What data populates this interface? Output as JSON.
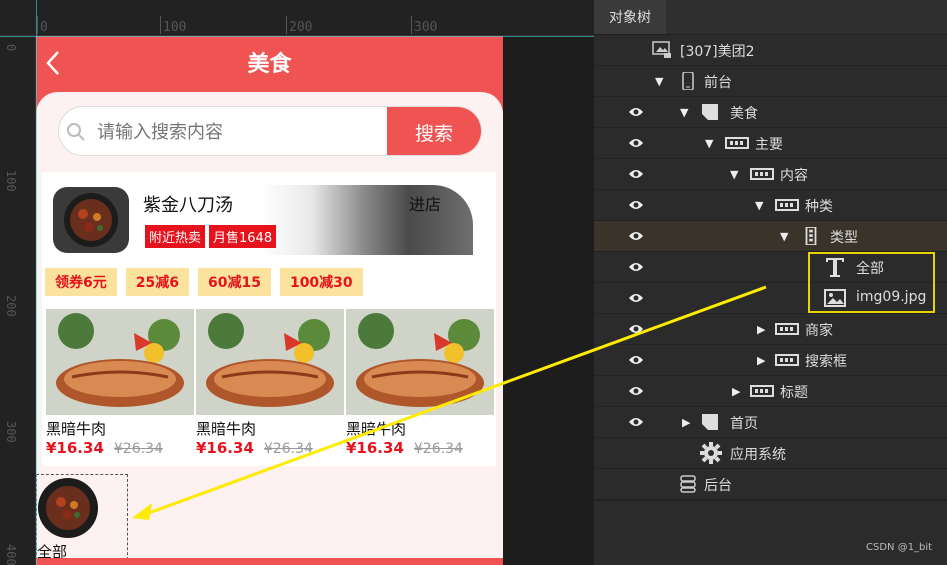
{
  "ruler": {
    "h_ticks": [
      "0",
      "100",
      "200",
      "300"
    ],
    "v_ticks": [
      "0",
      "100",
      "200",
      "300",
      "400"
    ]
  },
  "phone": {
    "title": "美食",
    "back_icon": "chevron-left-icon",
    "search": {
      "placeholder": "请输入搜索内容",
      "button": "搜索"
    },
    "store": {
      "name": "紫金八刀汤",
      "enter": "进店",
      "tags": [
        "附近热卖",
        "月售1648"
      ]
    },
    "coupons": [
      "领券6元",
      "25减6",
      "60减15",
      "100减30"
    ],
    "products": [
      {
        "name": "黑暗牛肉",
        "price": "¥16.34",
        "old_price": "¥26.34"
      },
      {
        "name": "黑暗牛肉",
        "price": "¥16.34",
        "old_price": "¥26.34"
      },
      {
        "name": "黑暗牛肉",
        "price": "¥16.34",
        "old_price": "¥26.34"
      }
    ],
    "type_item": {
      "label": "全部"
    }
  },
  "panel": {
    "tab": "对象树",
    "tree": [
      {
        "label": "[307]美团2",
        "icon": "project-icon",
        "eye": false,
        "arrow": ""
      },
      {
        "label": "前台",
        "icon": "phone-icon",
        "eye": false,
        "arrow": "▼"
      },
      {
        "label": "美食",
        "icon": "page-icon",
        "eye": true,
        "arrow": "▼"
      },
      {
        "label": "主要",
        "icon": "panel-icon",
        "eye": true,
        "arrow": "▼"
      },
      {
        "label": "内容",
        "icon": "panel-icon",
        "eye": true,
        "arrow": "▼"
      },
      {
        "label": "种类",
        "icon": "panel-icon",
        "eye": true,
        "arrow": "▼"
      },
      {
        "label": "类型",
        "icon": "vertical-panel-icon",
        "eye": true,
        "arrow": "▼"
      },
      {
        "label": "全部",
        "icon": "text-icon",
        "eye": true,
        "arrow": ""
      },
      {
        "label": "img09.jpg",
        "icon": "image-icon",
        "eye": true,
        "arrow": ""
      },
      {
        "label": "商家",
        "icon": "panel-icon",
        "eye": true,
        "arrow": "▶"
      },
      {
        "label": "搜索框",
        "icon": "panel-icon",
        "eye": true,
        "arrow": "▶"
      },
      {
        "label": "标题",
        "icon": "panel-icon",
        "eye": true,
        "arrow": "▶"
      },
      {
        "label": "首页",
        "icon": "page-icon",
        "eye": true,
        "arrow": "▶"
      },
      {
        "label": "应用系统",
        "icon": "gear-icon",
        "eye": false,
        "arrow": ""
      },
      {
        "label": "后台",
        "icon": "backend-icon",
        "eye": false,
        "arrow": ""
      }
    ],
    "watermark": "CSDN @1_bit"
  },
  "colors": {
    "brand": "#ef5453",
    "price": "#e6131d",
    "coupon_bg": "#fce39d",
    "highlight": "#e6d500",
    "guide": "#3fd5d9"
  }
}
